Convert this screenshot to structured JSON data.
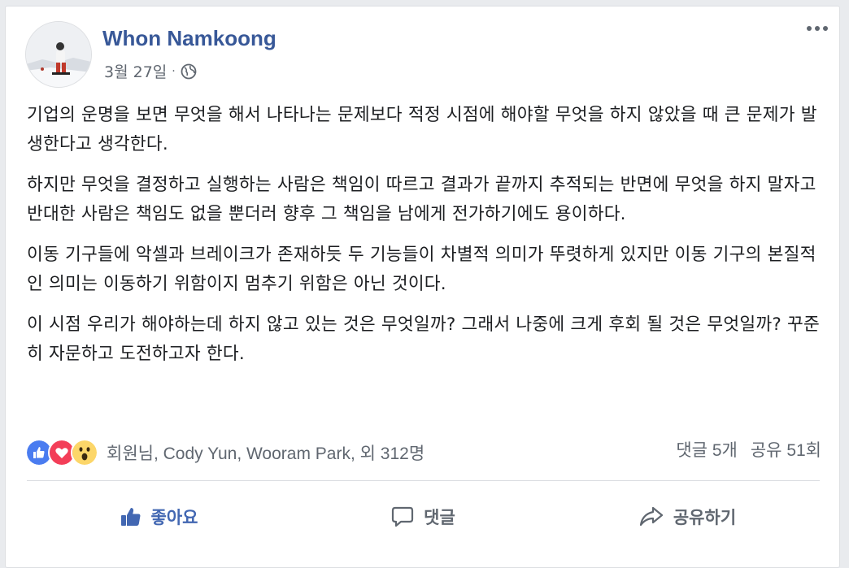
{
  "post": {
    "author": "Whon Namkoong",
    "date": "3월 27일",
    "separator": "·",
    "privacy_icon": "globe-icon",
    "paragraphs": [
      "기업의 운명을 보면 무엇을 해서 나타나는 문제보다 적정 시점에 해야할 무엇을 하지 않았을 때 큰 문제가 발생한다고 생각한다.",
      "하지만 무엇을 결정하고 실행하는 사람은 책임이 따르고 결과가 끝까지 추적되는 반면에 무엇을 하지 말자고 반대한 사람은 책임도 없을 뿐더러 향후 그 책임을 남에게 전가하기에도 용이하다.",
      "이동 기구들에 악셀과 브레이크가 존재하듯 두 기능들이 차별적 의미가 뚜렷하게 있지만 이동 기구의 본질적인 의미는 이동하기 위함이지 멈추기 위함은 아닌 것이다.",
      "이 시점 우리가 해야하는데 하지 않고 있는 것은 무엇일까? 그래서 나중에 크게 후회 될 것은 무엇일까? 꾸준히 자문하고 도전하고자 한다."
    ]
  },
  "reactions": {
    "icons": [
      "like-icon",
      "love-icon",
      "wow-icon"
    ],
    "names": "회원님, Cody Yun, Wooram Park, 외 312명",
    "comments": "댓글 5개",
    "shares": "공유 51회"
  },
  "actions": {
    "like": "좋아요",
    "comment": "댓글",
    "share": "공유하기"
  },
  "colors": {
    "name": "#385898",
    "like_blue": "#4267b2",
    "love_red": "#f33e58",
    "wow_yellow": "#fcd669",
    "muted": "#606770"
  }
}
